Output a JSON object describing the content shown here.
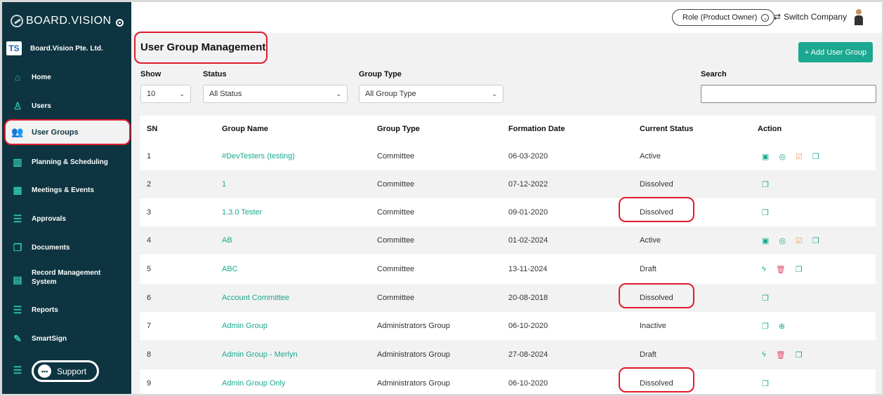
{
  "sidebar": {
    "logo_text": "BOARD.VISION",
    "company_name": "Board.Vision Pte. Ltd.",
    "company_logo_text": "TS",
    "items": [
      {
        "label": "Home",
        "icon": "home-icon"
      },
      {
        "label": "Users",
        "icon": "user-icon"
      },
      {
        "label": "User Groups",
        "icon": "users-icon"
      },
      {
        "label": "Planning & Scheduling",
        "icon": "planning-icon"
      },
      {
        "label": "Meetings & Events",
        "icon": "calendar-icon"
      },
      {
        "label": "Approvals",
        "icon": "approvals-icon"
      },
      {
        "label": "Documents",
        "icon": "documents-icon"
      },
      {
        "label": "Record Management System",
        "icon": "records-icon"
      },
      {
        "label": "Reports",
        "icon": "reports-icon"
      },
      {
        "label": "SmartSign",
        "icon": "pen-icon"
      }
    ],
    "support_label": "Support"
  },
  "topbar": {
    "role_label": "Role (Product Owner)",
    "switch_label": "Switch Company"
  },
  "main": {
    "title": "User Group Management",
    "add_button": "+ Add User Group",
    "filters": {
      "show_label": "Show",
      "show_value": "10",
      "status_label": "Status",
      "status_value": "All Status",
      "group_type_label": "Group Type",
      "group_type_value": "All Group Type",
      "search_label": "Search",
      "search_value": ""
    },
    "table": {
      "headers": [
        "SN",
        "Group Name",
        "Group Type",
        "Formation Date",
        "Current Status",
        "Action"
      ],
      "rows": [
        {
          "sn": "1",
          "name": "#DevTesters (testing)",
          "type": "Committee",
          "date": "06-03-2020",
          "status": "Active",
          "actions": [
            "calendar-icon",
            "location-icon",
            "edit-icon",
            "copy-icon"
          ]
        },
        {
          "sn": "2",
          "name": "1",
          "type": "Committee",
          "date": "07-12-2022",
          "status": "Dissolved",
          "actions": [
            "copy-icon"
          ]
        },
        {
          "sn": "3",
          "name": "1.3.0 Tester",
          "type": "Committee",
          "date": "09-01-2020",
          "status": "Dissolved",
          "actions": [
            "copy-icon"
          ]
        },
        {
          "sn": "4",
          "name": "AB",
          "type": "Committee",
          "date": "01-02-2024",
          "status": "Active",
          "actions": [
            "calendar-icon",
            "location-icon",
            "edit-icon",
            "copy-icon"
          ]
        },
        {
          "sn": "5",
          "name": "ABC",
          "type": "Committee",
          "date": "13-11-2024",
          "status": "Draft",
          "actions": [
            "activate-icon",
            "delete-icon",
            "copy-icon"
          ]
        },
        {
          "sn": "6",
          "name": "Account Committee",
          "type": "Committee",
          "date": "20-08-2018",
          "status": "Dissolved",
          "actions": [
            "copy-icon"
          ]
        },
        {
          "sn": "7",
          "name": "Admin Group",
          "type": "Administrators Group",
          "date": "06-10-2020",
          "status": "Inactive",
          "actions": [
            "copy-icon",
            "reactivate-icon"
          ]
        },
        {
          "sn": "8",
          "name": "Admin Group - Merlyn",
          "type": "Administrators Group",
          "date": "27-08-2024",
          "status": "Draft",
          "actions": [
            "activate-icon",
            "delete-icon",
            "copy-icon"
          ]
        },
        {
          "sn": "9",
          "name": "Admin Group Only",
          "type": "Administrators Group",
          "date": "06-10-2020",
          "status": "Dissolved",
          "actions": [
            "copy-icon"
          ]
        }
      ]
    }
  },
  "colors": {
    "sidebar_bg": "#0d3440",
    "accent": "#1aa890",
    "highlight": "#e01b2b"
  }
}
